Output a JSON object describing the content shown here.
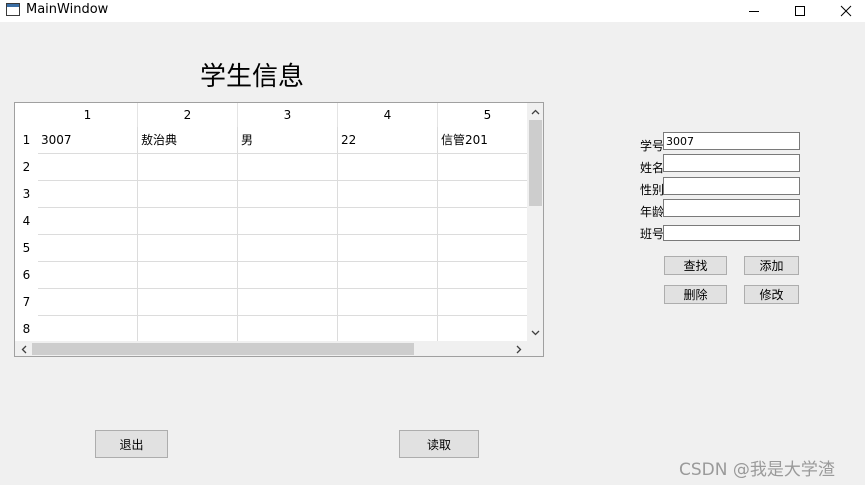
{
  "window": {
    "title": "MainWindow"
  },
  "page_title": "学生信息",
  "table": {
    "columns": [
      "1",
      "2",
      "3",
      "4",
      "5"
    ],
    "rows": [
      "1",
      "2",
      "3",
      "4",
      "5",
      "6",
      "7",
      "8"
    ],
    "cells": [
      [
        "3007",
        "敖治典",
        "男",
        "22",
        "信管201"
      ],
      [
        "",
        "",
        "",
        "",
        ""
      ],
      [
        "",
        "",
        "",
        "",
        ""
      ],
      [
        "",
        "",
        "",
        "",
        ""
      ],
      [
        "",
        "",
        "",
        "",
        ""
      ],
      [
        "",
        "",
        "",
        "",
        ""
      ],
      [
        "",
        "",
        "",
        "",
        ""
      ],
      [
        "",
        "",
        "",
        "",
        ""
      ]
    ]
  },
  "form": {
    "id_label": "学号",
    "id_value": "3007",
    "name_label": "姓名",
    "name_value": "",
    "gender_label": "性别",
    "gender_value": "",
    "age_label": "年龄",
    "age_value": "",
    "class_label": "班号",
    "class_value": ""
  },
  "buttons": {
    "find": "查找",
    "add": "添加",
    "delete": "删除",
    "modify": "修改",
    "exit": "退出",
    "read": "读取"
  },
  "watermark": "CSDN @我是大学渣",
  "icons": [
    "app-icon",
    "minimize-icon",
    "maximize-icon",
    "close-icon",
    "scroll-up-icon",
    "scroll-down-icon",
    "scroll-left-icon",
    "scroll-right-icon"
  ]
}
